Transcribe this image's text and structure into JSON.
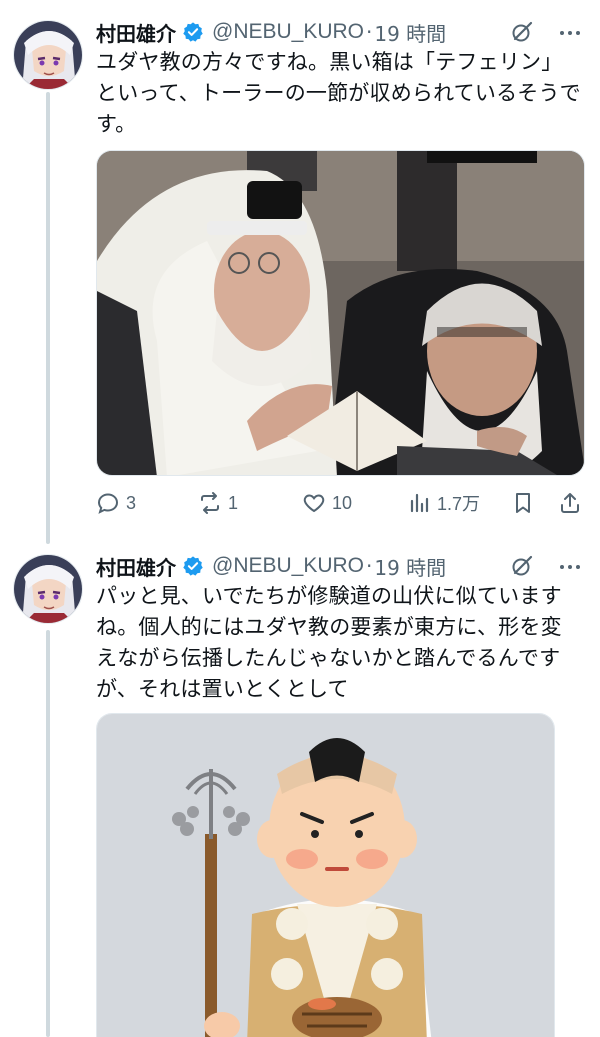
{
  "tweets": [
    {
      "author": {
        "name": "村田雄介",
        "handle": "@NEBU_KURO",
        "sep": "·",
        "time": "19 時間"
      },
      "text": "ユダヤ教の方々ですね。黒い箱は「テフェリン」といって、トーラーの一節が収められているそうです。",
      "media": {
        "description": "photo-rabbis-praying",
        "icon": "photo"
      },
      "actions": {
        "replies": "3",
        "retweets": "1",
        "likes": "10",
        "views": "1.7万"
      }
    },
    {
      "author": {
        "name": "村田雄介",
        "handle": "@NEBU_KURO",
        "sep": "·",
        "time": "19 時間"
      },
      "text": "パッと見、いでたちが修験道の山伏に似ていますね。個人的にはユダヤ教の要素が東方に、形を変えながら伝播したんじゃないかと踏んでるんですが、それは置いとくとして",
      "media": {
        "description": "illustration-yamabushi",
        "icon": "illustration"
      }
    }
  ],
  "colors": {
    "verified": "#1d9bf0",
    "secondary": "#536471",
    "thread": "#cfd9de",
    "text": "#0f1419"
  }
}
